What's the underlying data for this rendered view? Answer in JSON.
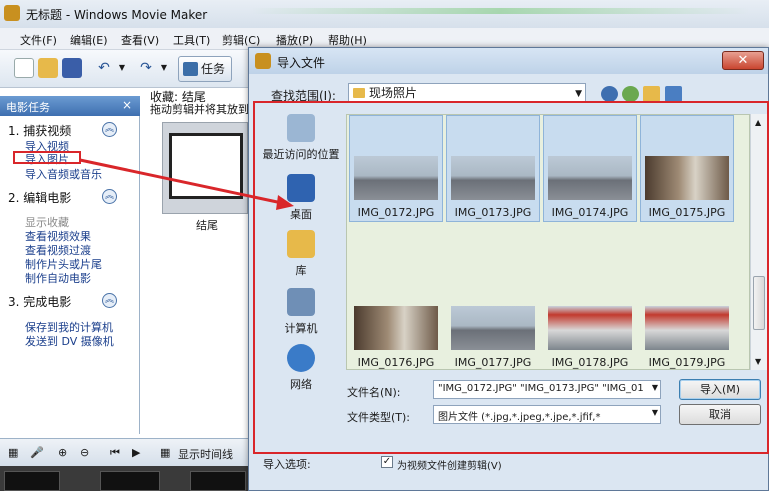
{
  "window": {
    "title": "无标题 - Windows Movie Maker"
  },
  "menu": [
    "文件(F)",
    "编辑(E)",
    "查看(V)",
    "工具(T)",
    "剪辑(C)",
    "播放(P)",
    "帮助(H)"
  ],
  "toolbar": {
    "task_label": "任务"
  },
  "task_panel": {
    "header": "电影任务",
    "sections": [
      {
        "title": "1. 捕获视频",
        "links": [
          "导入视频",
          "导入图片",
          "导入音频或音乐"
        ]
      },
      {
        "title": "2. 编辑电影",
        "links": [
          "显示收藏",
          "查看视频效果",
          "查看视频过渡",
          "制作片头或片尾",
          "制作自动电影"
        ]
      },
      {
        "title": "3. 完成电影",
        "links": [
          "保存到我的计算机",
          "发送到 DV 摄像机"
        ]
      }
    ]
  },
  "collection": {
    "title": "收藏: 结尾",
    "hint": "拖动剪辑并将其放到",
    "clip_caption": "结尾"
  },
  "bottom": {
    "show_timeline": "显示时间线"
  },
  "dialog": {
    "title": "导入文件",
    "look_in_label": "查找范围(I):",
    "look_in_value": "现场照片",
    "places": [
      "最近访问的位置",
      "桌面",
      "库",
      "计算机",
      "网络"
    ],
    "files": [
      {
        "name": "IMG_0172.JPG",
        "selected": true,
        "kind": "lot"
      },
      {
        "name": "IMG_0173.JPG",
        "selected": true,
        "kind": "lot"
      },
      {
        "name": "IMG_0174.JPG",
        "selected": true,
        "kind": "lot"
      },
      {
        "name": "IMG_0175.JPG",
        "selected": true,
        "kind": "indoor"
      },
      {
        "name": "IMG_0176.JPG",
        "selected": false,
        "kind": "indoor"
      },
      {
        "name": "IMG_0177.JPG",
        "selected": false,
        "kind": "lot"
      },
      {
        "name": "IMG_0178.JPG",
        "selected": false,
        "kind": "red"
      },
      {
        "name": "IMG_0179.JPG",
        "selected": false,
        "kind": "red"
      }
    ],
    "filename_label": "文件名(N):",
    "filename_value": "\"IMG_0172.JPG\" \"IMG_0173.JPG\" \"IMG_01",
    "filetype_label": "文件类型(T):",
    "filetype_value": "图片文件 (*.jpg,*.jpeg,*.jpe,*.jfif,*",
    "import_button": "导入(M)",
    "cancel_button": "取消",
    "import_options_label": "导入选项:",
    "create_clips_label": "为视频文件创建剪辑(V)",
    "create_clips_checked": true
  },
  "colors": {
    "highlight": "#d9262a",
    "panel_header": "#3e6fb0",
    "file_area": "#e8f0df"
  }
}
